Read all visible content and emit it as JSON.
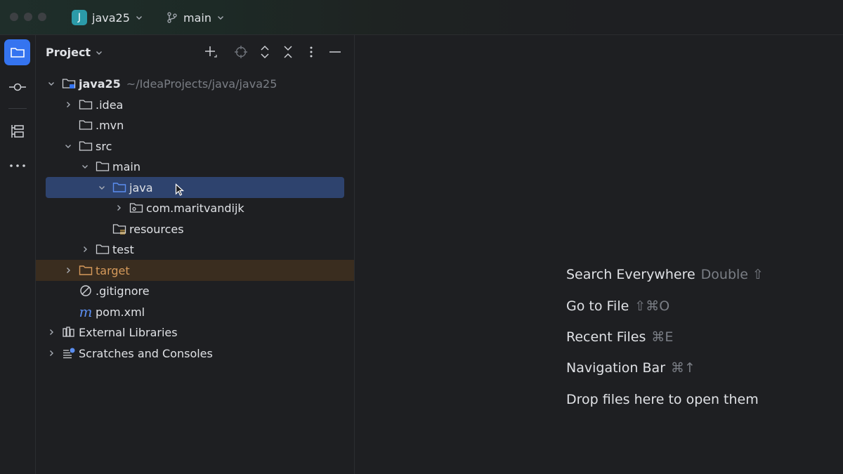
{
  "titlebar": {
    "project_badge": "J",
    "project_name": "java25",
    "branch_name": "main"
  },
  "toolstrip": {
    "items": [
      "project-icon",
      "commit-icon",
      "structure-icon",
      "more-icon"
    ]
  },
  "panel": {
    "title": "Project"
  },
  "tree": {
    "root": {
      "label": "java25",
      "path": "~/IdeaProjects/java/java25"
    },
    "idea": "idea",
    "mvn": ".mvn",
    "src": "src",
    "main": "main",
    "java": "java",
    "package": "com.maritvandijk",
    "resources": "resources",
    "test": "test",
    "target": "target",
    "gitignore": ".gitignore",
    "pom": "pom.xml",
    "external": "External Libraries",
    "scratches": "Scratches and Consoles"
  },
  "editor": {
    "hints": [
      {
        "label": "Search Everywhere",
        "shortcut": "Double ⇧"
      },
      {
        "label": "Go to File",
        "shortcut": "⇧⌘O"
      },
      {
        "label": "Recent Files",
        "shortcut": "⌘E"
      },
      {
        "label": "Navigation Bar",
        "shortcut": "⌘↑"
      },
      {
        "label": "Drop files here to open them",
        "shortcut": ""
      }
    ]
  },
  "colors": {
    "selection": "#2e436e",
    "accent": "#3574f0",
    "excluded_folder": "#d69a5b",
    "maven": "#5b8ef0"
  }
}
